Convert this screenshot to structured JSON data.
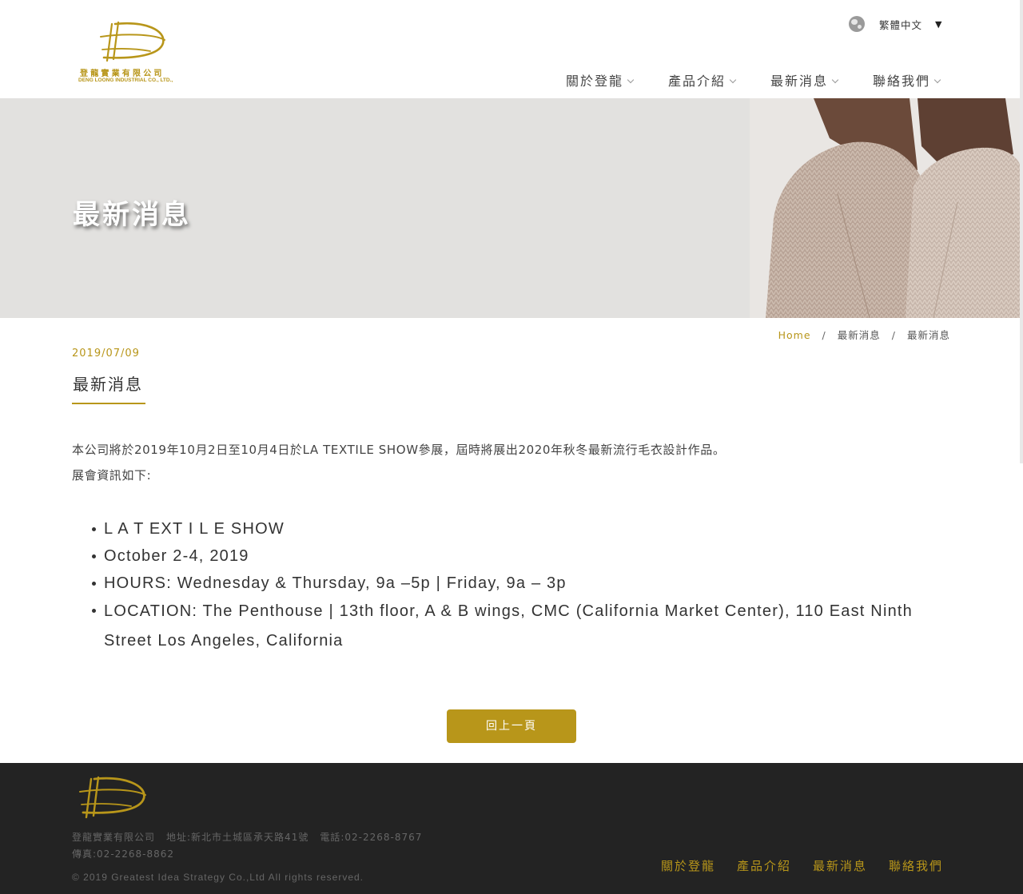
{
  "header": {
    "logo": {
      "company_cn": "登龍實業有限公司",
      "company_en": "DENG LOONG INDUSTRIAL CO., LTD.,"
    },
    "language": {
      "label": "繁體中文",
      "arrow": "▼",
      "icon": "globe-icon"
    },
    "nav": [
      {
        "label": "關於登龍",
        "icon": "chevron-down-icon"
      },
      {
        "label": "產品介紹",
        "icon": "chevron-down-icon"
      },
      {
        "label": "最新消息",
        "icon": "chevron-down-icon"
      },
      {
        "label": "聯絡我們",
        "icon": "chevron-down-icon"
      }
    ]
  },
  "banner": {
    "title": "最新消息"
  },
  "breadcrumb": {
    "items": [
      "Home",
      "最新消息",
      "最新消息"
    ],
    "separator": "/"
  },
  "article": {
    "date": "2019/07/09",
    "title": "最新消息",
    "paragraphs": [
      "本公司將於2019年10月2日至10月4日於LA TEXTILE SHOW參展，屆時將展出2020年秋冬最新流行毛衣設計作品。",
      "展會資訊如下:"
    ],
    "list": [
      "L A T EXT I L E SHOW",
      "October 2-4, 2019",
      "HOURS: Wednesday & Thursday, 9a –5p | Friday, 9a – 3p",
      "LOCATION: The Penthouse | 13th floor, A & B wings, CMC (California Market Center), 110 East Ninth Street Los Angeles, California"
    ],
    "back_button": "回上一頁"
  },
  "footer": {
    "company": "登龍實業有限公司",
    "address": "地址:新北市土城區承天路41號",
    "phone": "電話:02-2268-8767",
    "fax": "傳真:02-2268-8862",
    "copyright": "© 2019 Greatest Idea Strategy Co.,Ltd All rights reserved.",
    "nav": [
      "關於登龍",
      "產品介紹",
      "最新消息",
      "聯絡我們"
    ]
  },
  "colors": {
    "accent": "#b8961a",
    "footer_bg": "#232323",
    "banner_bg": "#e2e1df"
  }
}
